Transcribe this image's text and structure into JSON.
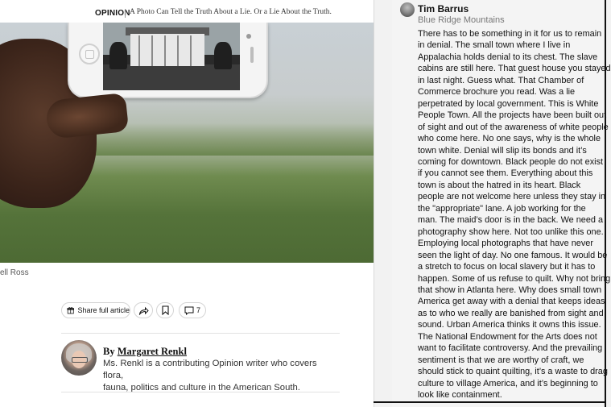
{
  "header": {
    "section": "OPINION",
    "headline": "A Photo Can Tell the Truth About a Lie. Or a Lie About the Truth."
  },
  "photo": {
    "credit_fragment": "ell Ross"
  },
  "toolbar": {
    "share_full_label": "Share full article",
    "comments_count": "7",
    "icons": [
      "gift-icon",
      "share-icon",
      "bookmark-icon",
      "comment-icon"
    ]
  },
  "author": {
    "by": "By",
    "name": "Margaret Renkl",
    "bio_lines": [
      "Ms. Renkl is a contributing Opinion writer who covers flora,",
      "fauna, politics and culture in the American South."
    ]
  },
  "comment": {
    "author": "Tim Barrus",
    "location": "Blue Ridge Mountains",
    "lines": [
      "There has to be something in it for us to remain",
      "in denial. The small town where I live in",
      "Appalachia holds denial to its chest. The slave",
      "cabins are still here. That guest house you stayed",
      "in last night. Guess what. That Chamber of",
      "Commerce brochure you read. Was a lie",
      "perpetrated by local government. This is White",
      "People Town. All the projects have been built out",
      "of sight and out of the awareness of white people",
      "who come here. No one says, why is the whole",
      "town white. Denial will slip its bonds and it’s",
      "coming for downtown. Black people do not exist",
      "if you cannot see them. Everything about this",
      "town is about the hatred in its heart. Black",
      "people are not welcome here unless they stay in",
      "the \"appropriate\" lane. A job working for the",
      "man. The maid’s door is in the back. We need a",
      "photography show here. Not too unlike this one.",
      "Employing local photographs that have never",
      "seen the light of day. No one famous. It would be",
      "a stretch to focus on local slavery but it has to",
      "happen. Some of us refuse to quilt. Why not bring",
      "that show in Atlanta here. Why does small town",
      "America get away with a denial that keeps ideas",
      "as to who we really are banished from sight and",
      "sound. Urban America thinks it owns this issue.",
      "The National Endowment for the Arts does not",
      "want to facilitate controversy. And the prevailing",
      "sentiment is that we are worthy of craft, we",
      "should stick to quaint quilting, it’s a waste to drag",
      "culture to village America, and it’s beginning to",
      "look like containment."
    ]
  }
}
